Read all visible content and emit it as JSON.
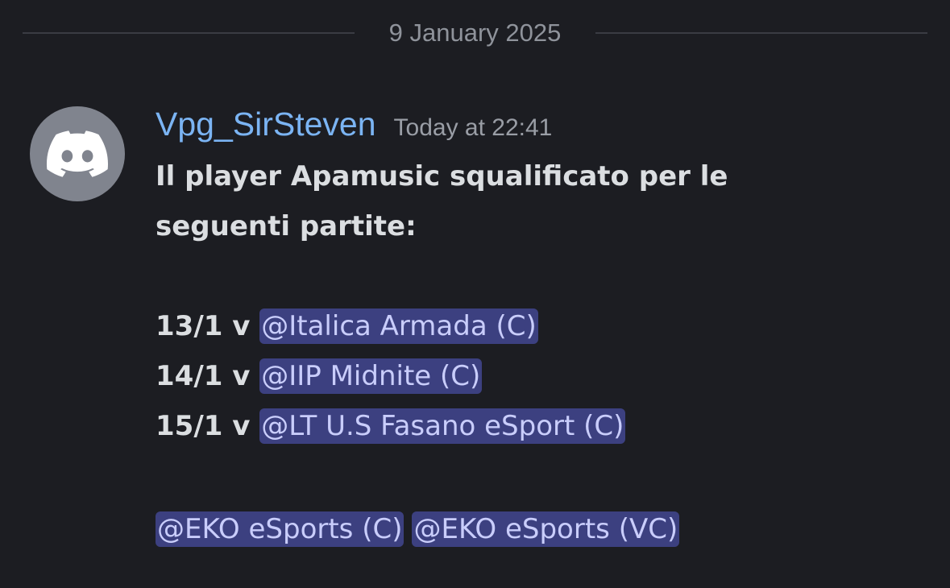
{
  "divider": {
    "date": "9 January 2025"
  },
  "message": {
    "avatar_icon": "discord-logo-icon",
    "author": "Vpg_SirSteven",
    "timestamp": "Today at 22:41",
    "lines": {
      "intro_1": "Il player Apamusic squalificato per le",
      "intro_2": "seguenti partite:",
      "match_1_date": "13/1 v ",
      "match_1_mention": "@Italica Armada (C)",
      "match_2_date": "14/1 v ",
      "match_2_mention": "@IIP Midnite (C)",
      "match_3_date": "15/1 v ",
      "match_3_mention": "@LT U.S Fasano eSport (C)",
      "footer_mention_1": "@EKO eSports (C)",
      "footer_mention_2": "@EKO eSports (VC)"
    }
  },
  "colors": {
    "background": "#1c1d22",
    "username": "#7bb4f3",
    "mention_bg": "#3c4080",
    "mention_text": "#c9cdfb"
  }
}
